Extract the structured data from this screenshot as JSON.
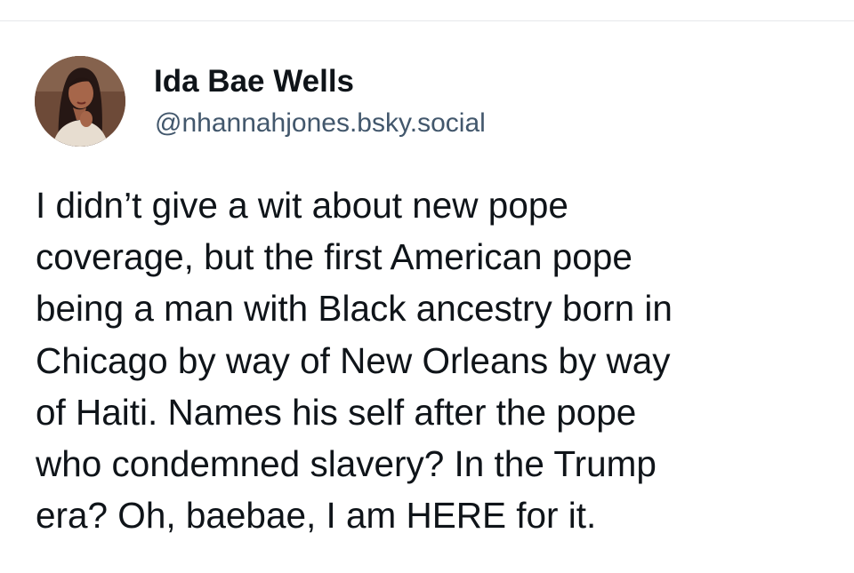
{
  "post": {
    "author": {
      "display_name": "Ida Bae Wells",
      "handle": "@nhannahjones.bsky.social"
    },
    "text_lines": [
      "I didn’t give a wit about new pope",
      "coverage, but the first American pope",
      "being a man with Black ancestry born in",
      "Chicago by way of New Orleans by way",
      "of Haiti. Names his self after the pope",
      "who condemned slavery? In the Trump",
      "era? Oh, baebae, I am HERE for it."
    ]
  },
  "icons": {
    "avatar": "author-avatar-photo"
  },
  "colors": {
    "background": "#ffffff",
    "text": "#0f1419",
    "handle": "#42576c",
    "divider": "#e6e8eb"
  }
}
